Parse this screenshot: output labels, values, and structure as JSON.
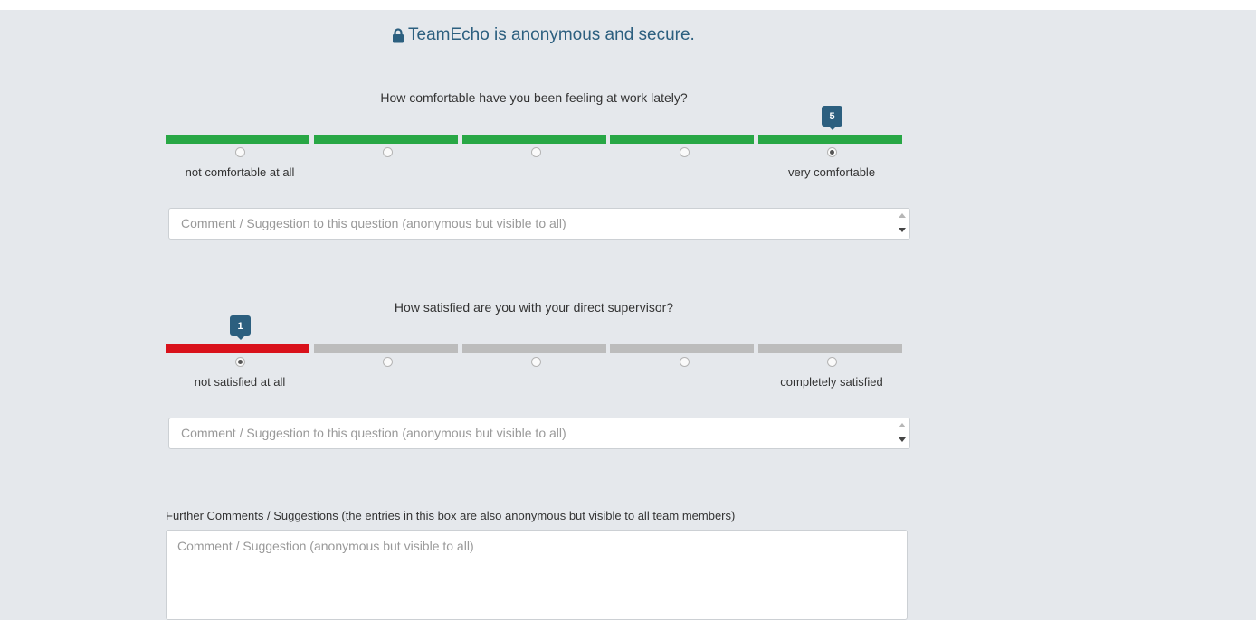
{
  "banner": {
    "text": "TeamEcho is anonymous and secure.",
    "icon": "lock-icon",
    "color": "#2c5f7f"
  },
  "questions": [
    {
      "text": "How comfortable have you been feeling at work lately?",
      "scale": [
        1,
        2,
        3,
        4,
        5
      ],
      "selected": 5,
      "selected_label": "5",
      "low_label": "not comfortable at all",
      "high_label": "very comfortable",
      "bar_color": "#28a745",
      "comment_placeholder": "Comment / Suggestion to this question (anonymous but visible to all)"
    },
    {
      "text": "How satisfied are you with your direct supervisor?",
      "scale": [
        1,
        2,
        3,
        4,
        5
      ],
      "selected": 1,
      "selected_label": "1",
      "low_label": "not satisfied at all",
      "high_label": "completely satisfied",
      "bar_color": "#d9111b",
      "inactive_color": "#bcbcbc",
      "comment_placeholder": "Comment / Suggestion to this question (anonymous but visible to all)"
    }
  ],
  "further": {
    "label": "Further Comments / Suggestions (the entries in this box are also anonymous but visible to all team members)",
    "placeholder": "Comment / Suggestion (anonymous but visible to all)"
  }
}
